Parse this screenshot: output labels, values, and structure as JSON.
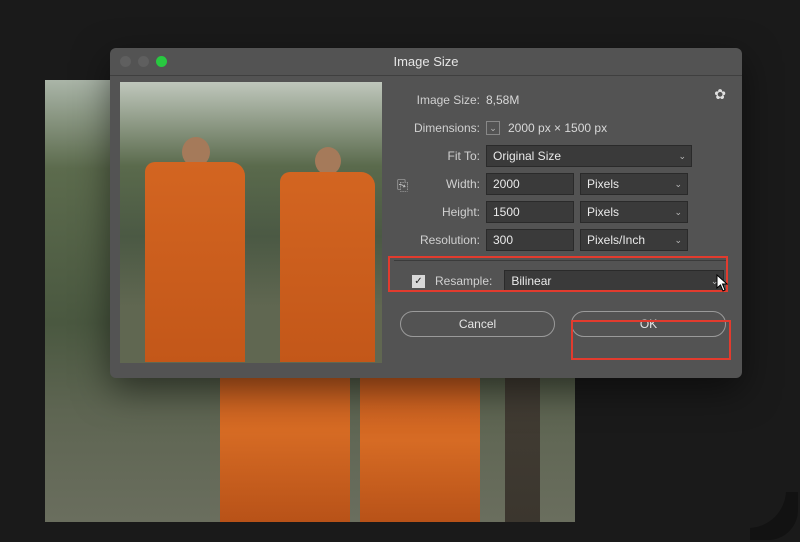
{
  "colors": {
    "highlight": "#e23b2e",
    "accent": "#28c840"
  },
  "dialog": {
    "title": "Image Size",
    "image_size_label": "Image Size:",
    "image_size_value": "8,58M",
    "dimensions_label": "Dimensions:",
    "dimensions_value": "2000 px × 1500 px",
    "fit_to_label": "Fit To:",
    "fit_to_value": "Original Size",
    "width_label": "Width:",
    "width_value": "2000",
    "height_label": "Height:",
    "height_value": "1500",
    "resolution_label": "Resolution:",
    "resolution_value": "300",
    "unit_pixels": "Pixels",
    "unit_ppi": "Pixels/Inch",
    "resample_label": "Resample:",
    "resample_value": "Bilinear",
    "cancel_label": "Cancel",
    "ok_label": "OK"
  }
}
